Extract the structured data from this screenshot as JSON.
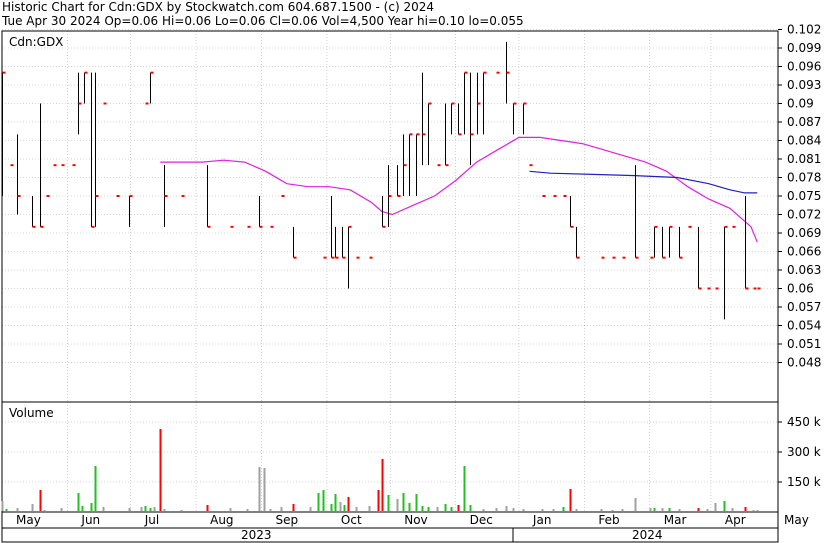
{
  "header": {
    "title": "Historic Chart for Cdn:GDX by Stockwatch.com 604.687.1500 - (c) 2024",
    "summary": "Tue Apr 30 2024  Op=0.06  Hi=0.06  Lo=0.06  Cl=0.06  Vol=4,500  Year hi=0.10  lo=0.055"
  },
  "colors": {
    "price_bar": "#000000",
    "close_tick": "#ff0000",
    "ma_short": "#e020e0",
    "ma_long": "#2020c0",
    "grid": "#b0b0b0",
    "vol_up": "#20c020",
    "vol_down": "#ff0000",
    "vol_flat": "#a0a0a0"
  },
  "chart_data": [
    {
      "type": "line",
      "title": "Cdn:GDX",
      "xlabel": "",
      "ylabel": "",
      "ylim": [
        0.045,
        0.103
      ],
      "yticks": [
        "0.102",
        "0.099",
        "0.096",
        "0.093",
        "0.09",
        "0.087",
        "0.084",
        "0.081",
        "0.078",
        "0.075",
        "0.072",
        "0.069",
        "0.066",
        "0.063",
        "0.06",
        "0.057",
        "0.054",
        "0.051",
        "0.048"
      ],
      "x_month_labels": [
        "May",
        "Jun",
        "Jul",
        "Aug",
        "Sep",
        "Oct",
        "Nov",
        "Dec",
        "Jan",
        "Feb",
        "Mar",
        "Apr",
        "May"
      ],
      "x_year_labels": [
        "2023",
        "2024"
      ],
      "x_range_days": [
        0,
        364
      ],
      "price_bars": [
        {
          "d": 0,
          "hi": 0.095,
          "lo": 0.075,
          "cl": 0.095
        },
        {
          "d": 4,
          "hi": 0.08,
          "lo": 0.08,
          "cl": 0.08
        },
        {
          "d": 7,
          "hi": 0.085,
          "lo": 0.072,
          "cl": 0.075
        },
        {
          "d": 14,
          "hi": 0.075,
          "lo": 0.07,
          "cl": 0.07
        },
        {
          "d": 18,
          "hi": 0.09,
          "lo": 0.07,
          "cl": 0.07
        },
        {
          "d": 21,
          "hi": 0.075,
          "lo": 0.075,
          "cl": 0.075
        },
        {
          "d": 24,
          "hi": 0.08,
          "lo": 0.08,
          "cl": 0.08
        },
        {
          "d": 28,
          "hi": 0.08,
          "lo": 0.08,
          "cl": 0.08
        },
        {
          "d": 33,
          "hi": 0.08,
          "lo": 0.08,
          "cl": 0.08
        },
        {
          "d": 36,
          "hi": 0.095,
          "lo": 0.085,
          "cl": 0.09
        },
        {
          "d": 39,
          "hi": 0.095,
          "lo": 0.09,
          "cl": 0.095
        },
        {
          "d": 42,
          "hi": 0.095,
          "lo": 0.07,
          "cl": 0.07
        },
        {
          "d": 44,
          "hi": 0.095,
          "lo": 0.07,
          "cl": 0.075
        },
        {
          "d": 48,
          "hi": 0.09,
          "lo": 0.09,
          "cl": 0.09
        },
        {
          "d": 54,
          "hi": 0.075,
          "lo": 0.075,
          "cl": 0.075
        },
        {
          "d": 60,
          "hi": 0.075,
          "lo": 0.07,
          "cl": 0.075
        },
        {
          "d": 68,
          "hi": 0.09,
          "lo": 0.09,
          "cl": 0.09
        },
        {
          "d": 70,
          "hi": 0.095,
          "lo": 0.09,
          "cl": 0.095
        },
        {
          "d": 77,
          "hi": 0.08,
          "lo": 0.07,
          "cl": 0.075
        },
        {
          "d": 85,
          "hi": 0.075,
          "lo": 0.075,
          "cl": 0.075
        },
        {
          "d": 97,
          "hi": 0.08,
          "lo": 0.07,
          "cl": 0.07
        },
        {
          "d": 108,
          "hi": 0.07,
          "lo": 0.07,
          "cl": 0.07
        },
        {
          "d": 116,
          "hi": 0.07,
          "lo": 0.07,
          "cl": 0.07
        },
        {
          "d": 122,
          "hi": 0.075,
          "lo": 0.07,
          "cl": 0.07
        },
        {
          "d": 127,
          "hi": 0.07,
          "lo": 0.07,
          "cl": 0.07
        },
        {
          "d": 132,
          "hi": 0.075,
          "lo": 0.075,
          "cl": 0.075
        },
        {
          "d": 138,
          "hi": 0.07,
          "lo": 0.065,
          "cl": 0.065
        },
        {
          "d": 152,
          "hi": 0.065,
          "lo": 0.065,
          "cl": 0.065
        },
        {
          "d": 156,
          "hi": 0.075,
          "lo": 0.065,
          "cl": 0.065
        },
        {
          "d": 158,
          "hi": 0.07,
          "lo": 0.065,
          "cl": 0.065
        },
        {
          "d": 161,
          "hi": 0.07,
          "lo": 0.065,
          "cl": 0.065
        },
        {
          "d": 164,
          "hi": 0.07,
          "lo": 0.06,
          "cl": 0.07
        },
        {
          "d": 168,
          "hi": 0.065,
          "lo": 0.065,
          "cl": 0.065
        },
        {
          "d": 174,
          "hi": 0.065,
          "lo": 0.065,
          "cl": 0.065
        },
        {
          "d": 180,
          "hi": 0.075,
          "lo": 0.07,
          "cl": 0.07
        },
        {
          "d": 183,
          "hi": 0.08,
          "lo": 0.07,
          "cl": 0.075
        },
        {
          "d": 187,
          "hi": 0.08,
          "lo": 0.075,
          "cl": 0.075
        },
        {
          "d": 190,
          "hi": 0.085,
          "lo": 0.075,
          "cl": 0.08
        },
        {
          "d": 193,
          "hi": 0.085,
          "lo": 0.075,
          "cl": 0.085
        },
        {
          "d": 196,
          "hi": 0.085,
          "lo": 0.075,
          "cl": 0.085
        },
        {
          "d": 199,
          "hi": 0.095,
          "lo": 0.08,
          "cl": 0.085
        },
        {
          "d": 202,
          "hi": 0.09,
          "lo": 0.08,
          "cl": 0.09
        },
        {
          "d": 206,
          "hi": 0.08,
          "lo": 0.08,
          "cl": 0.08
        },
        {
          "d": 210,
          "hi": 0.09,
          "lo": 0.08,
          "cl": 0.08
        },
        {
          "d": 213,
          "hi": 0.09,
          "lo": 0.085,
          "cl": 0.09
        },
        {
          "d": 216,
          "hi": 0.09,
          "lo": 0.085,
          "cl": 0.085
        },
        {
          "d": 219,
          "hi": 0.095,
          "lo": 0.085,
          "cl": 0.095
        },
        {
          "d": 222,
          "hi": 0.095,
          "lo": 0.08,
          "cl": 0.085
        },
        {
          "d": 225,
          "hi": 0.095,
          "lo": 0.085,
          "cl": 0.09
        },
        {
          "d": 228,
          "hi": 0.095,
          "lo": 0.085,
          "cl": 0.095
        },
        {
          "d": 234,
          "hi": 0.095,
          "lo": 0.095,
          "cl": 0.095
        },
        {
          "d": 239,
          "hi": 0.1,
          "lo": 0.09,
          "cl": 0.095
        },
        {
          "d": 242,
          "hi": 0.09,
          "lo": 0.085,
          "cl": 0.09
        },
        {
          "d": 247,
          "hi": 0.09,
          "lo": 0.085,
          "cl": 0.09
        },
        {
          "d": 250,
          "hi": 0.08,
          "lo": 0.08,
          "cl": 0.08
        },
        {
          "d": 256,
          "hi": 0.075,
          "lo": 0.075,
          "cl": 0.075
        },
        {
          "d": 261,
          "hi": 0.075,
          "lo": 0.075,
          "cl": 0.075
        },
        {
          "d": 266,
          "hi": 0.075,
          "lo": 0.075,
          "cl": 0.075
        },
        {
          "d": 269,
          "hi": 0.075,
          "lo": 0.07,
          "cl": 0.07
        },
        {
          "d": 272,
          "hi": 0.07,
          "lo": 0.065,
          "cl": 0.065
        },
        {
          "d": 284,
          "hi": 0.065,
          "lo": 0.065,
          "cl": 0.065
        },
        {
          "d": 289,
          "hi": 0.065,
          "lo": 0.065,
          "cl": 0.065
        },
        {
          "d": 294,
          "hi": 0.065,
          "lo": 0.065,
          "cl": 0.065
        },
        {
          "d": 300,
          "hi": 0.08,
          "lo": 0.065,
          "cl": 0.065
        },
        {
          "d": 307,
          "hi": 0.065,
          "lo": 0.065,
          "cl": 0.065
        },
        {
          "d": 309,
          "hi": 0.07,
          "lo": 0.065,
          "cl": 0.07
        },
        {
          "d": 313,
          "hi": 0.07,
          "lo": 0.065,
          "cl": 0.065
        },
        {
          "d": 316,
          "hi": 0.07,
          "lo": 0.065,
          "cl": 0.07
        },
        {
          "d": 321,
          "hi": 0.07,
          "lo": 0.065,
          "cl": 0.065
        },
        {
          "d": 325,
          "hi": 0.07,
          "lo": 0.07,
          "cl": 0.07
        },
        {
          "d": 330,
          "hi": 0.07,
          "lo": 0.06,
          "cl": 0.06
        },
        {
          "d": 334,
          "hi": 0.06,
          "lo": 0.06,
          "cl": 0.06
        },
        {
          "d": 338,
          "hi": 0.06,
          "lo": 0.06,
          "cl": 0.06
        },
        {
          "d": 342,
          "hi": 0.07,
          "lo": 0.055,
          "cl": 0.07
        },
        {
          "d": 346,
          "hi": 0.07,
          "lo": 0.07,
          "cl": 0.07
        },
        {
          "d": 352,
          "hi": 0.075,
          "lo": 0.06,
          "cl": 0.06
        },
        {
          "d": 356,
          "hi": 0.06,
          "lo": 0.06,
          "cl": 0.06
        },
        {
          "d": 358,
          "hi": 0.06,
          "lo": 0.06,
          "cl": 0.06
        }
      ],
      "series": [
        {
          "x": [
            75,
            85,
            95,
            105,
            115,
            125,
            135,
            145,
            155,
            165,
            175,
            180,
            185,
            195,
            205,
            215,
            225,
            235,
            245,
            255,
            265,
            275,
            285,
            295,
            305,
            315,
            325,
            335,
            345,
            355,
            358
          ],
          "y": [
            0.0805,
            0.0805,
            0.0805,
            0.0808,
            0.0805,
            0.079,
            0.077,
            0.0765,
            0.0765,
            0.076,
            0.074,
            0.0725,
            0.072,
            0.0735,
            0.075,
            0.0775,
            0.0805,
            0.0825,
            0.0845,
            0.0845,
            0.084,
            0.0835,
            0.0825,
            0.0815,
            0.0805,
            0.079,
            0.0765,
            0.0745,
            0.073,
            0.07,
            0.0675
          ]
        },
        {
          "x": [
            250,
            260,
            280,
            300,
            320,
            335,
            345,
            352,
            358
          ],
          "y": [
            0.079,
            0.0787,
            0.0785,
            0.0783,
            0.078,
            0.077,
            0.076,
            0.0755,
            0.0755
          ]
        }
      ]
    },
    {
      "type": "bar",
      "title": "Volume",
      "yticks": [
        "450 k",
        "300 k",
        "150 k"
      ],
      "ylim": [
        0,
        540
      ],
      "values": [
        {
          "d": 0,
          "v": 55,
          "c": "flat"
        },
        {
          "d": 2,
          "v": 15,
          "c": "up"
        },
        {
          "d": 7,
          "v": 20,
          "c": "flat"
        },
        {
          "d": 14,
          "v": 40,
          "c": "flat"
        },
        {
          "d": 18,
          "v": 110,
          "c": "down"
        },
        {
          "d": 20,
          "v": 10,
          "c": "flat"
        },
        {
          "d": 28,
          "v": 20,
          "c": "flat"
        },
        {
          "d": 36,
          "v": 95,
          "c": "up"
        },
        {
          "d": 38,
          "v": 30,
          "c": "up"
        },
        {
          "d": 42,
          "v": 45,
          "c": "up"
        },
        {
          "d": 44,
          "v": 230,
          "c": "up"
        },
        {
          "d": 48,
          "v": 25,
          "c": "flat"
        },
        {
          "d": 60,
          "v": 20,
          "c": "flat"
        },
        {
          "d": 66,
          "v": 25,
          "c": "flat"
        },
        {
          "d": 68,
          "v": 30,
          "c": "up"
        },
        {
          "d": 70,
          "v": 20,
          "c": "up"
        },
        {
          "d": 72,
          "v": 25,
          "c": "flat"
        },
        {
          "d": 75,
          "v": 415,
          "c": "down"
        },
        {
          "d": 77,
          "v": 15,
          "c": "flat"
        },
        {
          "d": 85,
          "v": 10,
          "c": "flat"
        },
        {
          "d": 97,
          "v": 35,
          "c": "down"
        },
        {
          "d": 108,
          "v": 20,
          "c": "flat"
        },
        {
          "d": 116,
          "v": 15,
          "c": "flat"
        },
        {
          "d": 122,
          "v": 225,
          "c": "flat"
        },
        {
          "d": 124,
          "v": 220,
          "c": "flat"
        },
        {
          "d": 127,
          "v": 15,
          "c": "flat"
        },
        {
          "d": 132,
          "v": 25,
          "c": "flat"
        },
        {
          "d": 138,
          "v": 40,
          "c": "down"
        },
        {
          "d": 146,
          "v": 25,
          "c": "flat"
        },
        {
          "d": 150,
          "v": 95,
          "c": "up"
        },
        {
          "d": 152,
          "v": 110,
          "c": "up"
        },
        {
          "d": 156,
          "v": 40,
          "c": "up"
        },
        {
          "d": 158,
          "v": 90,
          "c": "up"
        },
        {
          "d": 160,
          "v": 50,
          "c": "flat"
        },
        {
          "d": 162,
          "v": 35,
          "c": "up"
        },
        {
          "d": 164,
          "v": 75,
          "c": "down"
        },
        {
          "d": 168,
          "v": 25,
          "c": "flat"
        },
        {
          "d": 174,
          "v": 30,
          "c": "flat"
        },
        {
          "d": 178,
          "v": 110,
          "c": "down"
        },
        {
          "d": 180,
          "v": 265,
          "c": "down"
        },
        {
          "d": 183,
          "v": 85,
          "c": "up"
        },
        {
          "d": 187,
          "v": 65,
          "c": "flat"
        },
        {
          "d": 190,
          "v": 95,
          "c": "up"
        },
        {
          "d": 193,
          "v": 45,
          "c": "up"
        },
        {
          "d": 196,
          "v": 90,
          "c": "up"
        },
        {
          "d": 199,
          "v": 30,
          "c": "up"
        },
        {
          "d": 202,
          "v": 25,
          "c": "up"
        },
        {
          "d": 206,
          "v": 25,
          "c": "flat"
        },
        {
          "d": 210,
          "v": 40,
          "c": "up"
        },
        {
          "d": 213,
          "v": 25,
          "c": "up"
        },
        {
          "d": 216,
          "v": 35,
          "c": "down"
        },
        {
          "d": 219,
          "v": 230,
          "c": "up"
        },
        {
          "d": 222,
          "v": 35,
          "c": "up"
        },
        {
          "d": 228,
          "v": 15,
          "c": "flat"
        },
        {
          "d": 234,
          "v": 20,
          "c": "flat"
        },
        {
          "d": 239,
          "v": 30,
          "c": "flat"
        },
        {
          "d": 242,
          "v": 20,
          "c": "flat"
        },
        {
          "d": 247,
          "v": 15,
          "c": "flat"
        },
        {
          "d": 256,
          "v": 15,
          "c": "flat"
        },
        {
          "d": 261,
          "v": 15,
          "c": "flat"
        },
        {
          "d": 266,
          "v": 25,
          "c": "up"
        },
        {
          "d": 269,
          "v": 115,
          "c": "down"
        },
        {
          "d": 272,
          "v": 15,
          "c": "flat"
        },
        {
          "d": 284,
          "v": 15,
          "c": "flat"
        },
        {
          "d": 289,
          "v": 10,
          "c": "flat"
        },
        {
          "d": 294,
          "v": 15,
          "c": "flat"
        },
        {
          "d": 300,
          "v": 70,
          "c": "flat"
        },
        {
          "d": 307,
          "v": 20,
          "c": "flat"
        },
        {
          "d": 309,
          "v": 20,
          "c": "up"
        },
        {
          "d": 313,
          "v": 20,
          "c": "flat"
        },
        {
          "d": 316,
          "v": 20,
          "c": "up"
        },
        {
          "d": 321,
          "v": 15,
          "c": "flat"
        },
        {
          "d": 330,
          "v": 20,
          "c": "down"
        },
        {
          "d": 334,
          "v": 15,
          "c": "flat"
        },
        {
          "d": 338,
          "v": 45,
          "c": "flat"
        },
        {
          "d": 342,
          "v": 55,
          "c": "up"
        },
        {
          "d": 346,
          "v": 20,
          "c": "flat"
        },
        {
          "d": 352,
          "v": 25,
          "c": "down"
        },
        {
          "d": 356,
          "v": 10,
          "c": "flat"
        },
        {
          "d": 358,
          "v": 10,
          "c": "flat"
        }
      ]
    }
  ]
}
